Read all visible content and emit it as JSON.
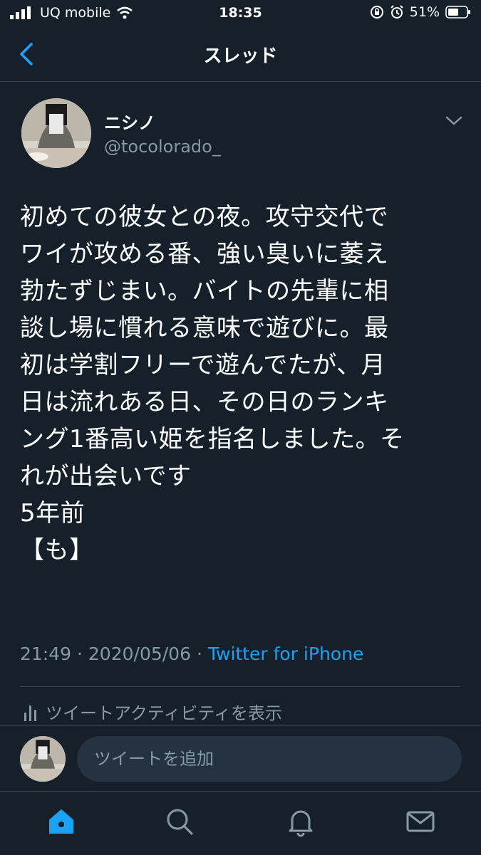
{
  "status_bar": {
    "carrier": "UQ mobile",
    "time": "18:35",
    "battery": "51%"
  },
  "nav": {
    "title": "スレッド",
    "back_icon": "chevron-left-icon"
  },
  "tweet": {
    "author_name": "ニシノ",
    "handle": "@tocolorado_",
    "text": "初めての彼女との夜。攻守交代で\nワイが攻める番、強い臭いに萎え\n勃たずじまい。バイトの先輩に相\n談し場に慣れる意味で遊びに。最\n初は学割フリーで遊んでたが、月\n日は流れある日、その日のランキ\nング1番高い姫を指名しました。そ\nれが出会いです\n5年前\n【も】",
    "time": "21:49",
    "separator": "·",
    "date": "2020/05/06",
    "source": "Twitter for iPhone",
    "activity_label": "ツイートアクティビティを表示"
  },
  "reply": {
    "placeholder": "ツイートを追加"
  },
  "tabs": [
    "home-icon",
    "search-icon",
    "notifications-icon",
    "messages-icon"
  ],
  "colors": {
    "background": "#15202b",
    "accent": "#1da1f2",
    "secondary_text": "#8899a6",
    "divider": "#38444d"
  }
}
